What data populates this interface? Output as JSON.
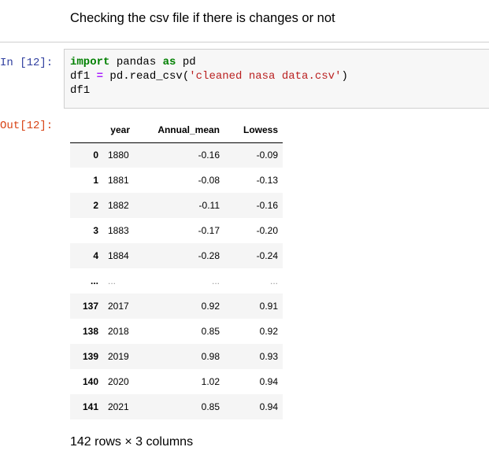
{
  "markdown": {
    "text": "Checking the csv file if there is changes or not"
  },
  "input_cell": {
    "prompt": "In [12]:",
    "code": {
      "line1": {
        "kw1": "import",
        "mid": " pandas ",
        "kw2": "as",
        "end": " pd"
      },
      "line2": {
        "start": "df1 ",
        "op": "=",
        "mid": " pd.read_csv(",
        "str": "'cleaned nasa data.csv'",
        "end": ")"
      },
      "line3": "df1"
    }
  },
  "output_cell": {
    "prompt": "Out[12]:",
    "table": {
      "columns": [
        "",
        "year",
        "Annual_mean",
        "Lowess"
      ],
      "rows": [
        {
          "index": "0",
          "year": "1880",
          "annual_mean": "-0.16",
          "lowess": "-0.09"
        },
        {
          "index": "1",
          "year": "1881",
          "annual_mean": "-0.08",
          "lowess": "-0.13"
        },
        {
          "index": "2",
          "year": "1882",
          "annual_mean": "-0.11",
          "lowess": "-0.16"
        },
        {
          "index": "3",
          "year": "1883",
          "annual_mean": "-0.17",
          "lowess": "-0.20"
        },
        {
          "index": "4",
          "year": "1884",
          "annual_mean": "-0.28",
          "lowess": "-0.24"
        },
        {
          "index": "...",
          "year": "...",
          "annual_mean": "...",
          "lowess": "..."
        },
        {
          "index": "137",
          "year": "2017",
          "annual_mean": "0.92",
          "lowess": "0.91"
        },
        {
          "index": "138",
          "year": "2018",
          "annual_mean": "0.85",
          "lowess": "0.92"
        },
        {
          "index": "139",
          "year": "2019",
          "annual_mean": "0.98",
          "lowess": "0.93"
        },
        {
          "index": "140",
          "year": "2020",
          "annual_mean": "1.02",
          "lowess": "0.94"
        },
        {
          "index": "141",
          "year": "2021",
          "annual_mean": "0.85",
          "lowess": "0.94"
        }
      ]
    },
    "footer": "142 rows × 3 columns"
  }
}
